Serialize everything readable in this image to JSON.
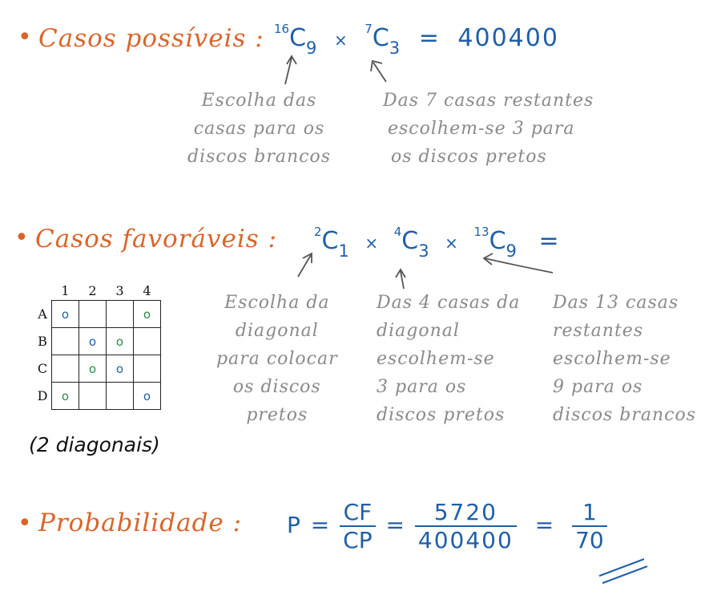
{
  "section1": {
    "bullet": "•",
    "title": "Casos possíveis :",
    "formula": {
      "t1_sup": "16",
      "t1_base": "C",
      "t1_sub": "9",
      "op1": "×",
      "t2_sup": "7",
      "t2_base": "C",
      "t2_sub": "3",
      "eq": "=",
      "result": "400400"
    },
    "note_left": [
      "Escolha das",
      "casas para os",
      "discos brancos"
    ],
    "note_right": [
      "Das 7 casas restantes",
      "escolhem-se 3 para",
      "os discos pretos"
    ]
  },
  "section2": {
    "bullet": "•",
    "title": "Casos favoráveis :",
    "formula": {
      "t1_sup": "2",
      "t1_base": "C",
      "t1_sub": "1",
      "op1": "×",
      "t2_sup": "4",
      "t2_base": "C",
      "t2_sub": "3",
      "op2": "×",
      "t3_sup": "13",
      "t3_base": "C",
      "t3_sub": "9",
      "eq": "="
    },
    "note1": [
      "Escolha da",
      "diagonal",
      "para colocar",
      "os discos",
      "pretos"
    ],
    "note2": [
      "Das 4 casas da",
      "diagonal",
      "escolhem-se",
      "3 para os",
      "discos pretos"
    ],
    "note3": [
      "Das 13 casas",
      "restantes",
      "escolhem-se",
      "9 para os",
      "discos brancos"
    ],
    "grid": {
      "cols": [
        "1",
        "2",
        "3",
        "4"
      ],
      "rows": [
        {
          "label": "A",
          "cells": [
            "o",
            "",
            "",
            "o"
          ]
        },
        {
          "label": "B",
          "cells": [
            "",
            "o",
            "o",
            ""
          ]
        },
        {
          "label": "C",
          "cells": [
            "",
            "o",
            "o",
            ""
          ]
        },
        {
          "label": "D",
          "cells": [
            "o",
            "",
            "",
            "o"
          ]
        }
      ]
    },
    "caption": "(2 diagonais)"
  },
  "section3": {
    "bullet": "•",
    "title": "Probabilidade :",
    "p": "P",
    "eq1": "=",
    "cf": "CF",
    "cp": "CP",
    "eq2": "=",
    "num": "5720",
    "den": "400400",
    "eq3": "=",
    "one": "1",
    "seventy": "70"
  },
  "colors": {
    "heading": "#d9652b",
    "formula": "#1f5fa8",
    "note": "#8a8a8a",
    "disc_blue": "#1f5fa8",
    "disc_green": "#2a8a4a"
  }
}
